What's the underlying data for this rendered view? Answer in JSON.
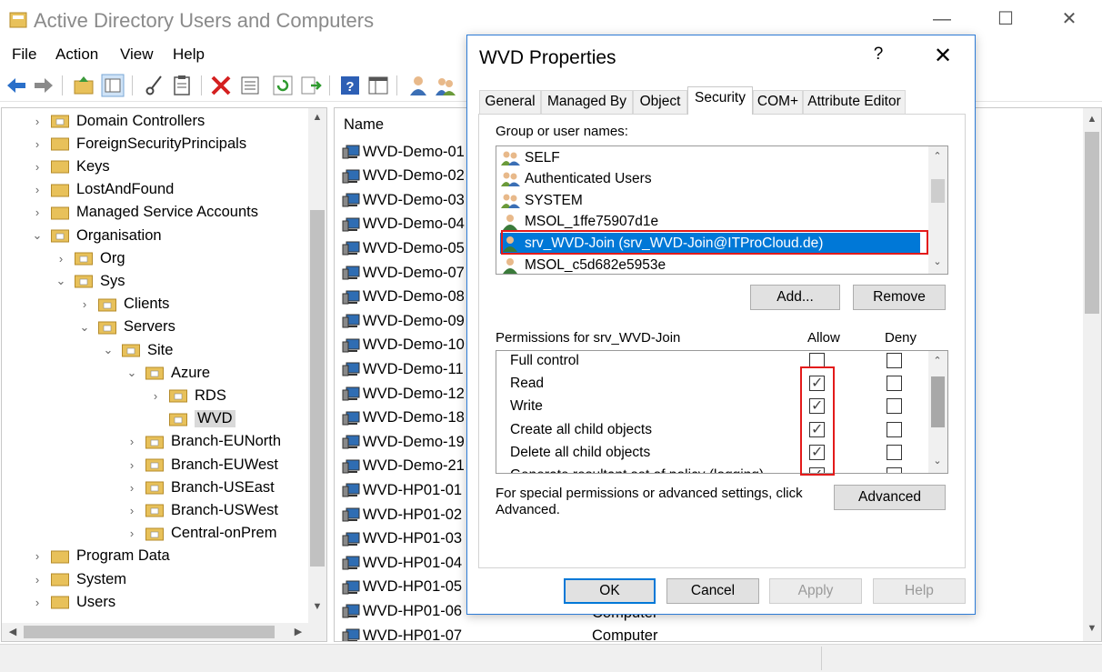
{
  "window": {
    "title": "Active Directory Users and Computers",
    "minimize": "—",
    "maximize": "☐",
    "close": "✕"
  },
  "menu": [
    "File",
    "Action",
    "View",
    "Help"
  ],
  "tree": {
    "items": [
      {
        "label": "Domain Controllers",
        "chevron": "›"
      },
      {
        "label": "ForeignSecurityPrincipals",
        "chevron": "›"
      },
      {
        "label": "Keys",
        "chevron": "›"
      },
      {
        "label": "LostAndFound",
        "chevron": "›"
      },
      {
        "label": "Managed Service Accounts",
        "chevron": "›"
      },
      {
        "label": "Organisation",
        "chevron": "⌄"
      },
      {
        "label": "Org",
        "chevron": "›"
      },
      {
        "label": "Sys",
        "chevron": "⌄"
      },
      {
        "label": "Clients",
        "chevron": "›"
      },
      {
        "label": "Servers",
        "chevron": "⌄"
      },
      {
        "label": "Site",
        "chevron": "⌄"
      },
      {
        "label": "Azure",
        "chevron": "⌄"
      },
      {
        "label": "RDS",
        "chevron": "›"
      },
      {
        "label": "WVD",
        "chevron": ""
      },
      {
        "label": "Branch-EUNorth",
        "chevron": "›"
      },
      {
        "label": "Branch-EUWest",
        "chevron": "›"
      },
      {
        "label": "Branch-USEast",
        "chevron": "›"
      },
      {
        "label": "Branch-USWest",
        "chevron": "›"
      },
      {
        "label": "Central-onPrem",
        "chevron": "›"
      },
      {
        "label": "Program Data",
        "chevron": "›"
      },
      {
        "label": "System",
        "chevron": "›"
      },
      {
        "label": "Users",
        "chevron": "›"
      }
    ],
    "selected": "WVD"
  },
  "list": {
    "column_name": "Name",
    "rows": [
      "WVD-Demo-01",
      "WVD-Demo-02",
      "WVD-Demo-03",
      "WVD-Demo-04",
      "WVD-Demo-05",
      "WVD-Demo-07",
      "WVD-Demo-08",
      "WVD-Demo-09",
      "WVD-Demo-10",
      "WVD-Demo-11",
      "WVD-Demo-12",
      "WVD-Demo-18",
      "WVD-Demo-19",
      "WVD-Demo-21",
      "WVD-HP01-01",
      "WVD-HP01-02",
      "WVD-HP01-03",
      "WVD-HP01-04",
      "WVD-HP01-05",
      "WVD-HP01-06",
      "WVD-HP01-07"
    ],
    "type_partial": "Computer",
    "type_partial_top": "Computer"
  },
  "dialog": {
    "title": "WVD Properties",
    "help": "?",
    "close": "✕",
    "tabs": [
      "General",
      "Managed By",
      "Object",
      "Security",
      "COM+",
      "Attribute Editor"
    ],
    "active_tab": "Security",
    "group_label": "Group or user names:",
    "users": [
      {
        "name": "SELF",
        "icon": "group-icon"
      },
      {
        "name": "Authenticated Users",
        "icon": "group-icon"
      },
      {
        "name": "SYSTEM",
        "icon": "group-icon"
      },
      {
        "name": "MSOL_1ffe75907d1e",
        "icon": "user-icon"
      },
      {
        "name": "srv_WVD-Join (srv_WVD-Join@ITProCloud.de)",
        "icon": "user-icon"
      },
      {
        "name": "MSOL_c5d682e5953e",
        "icon": "user-icon"
      }
    ],
    "selected_user": "srv_WVD-Join (srv_WVD-Join@ITProCloud.de)",
    "add_button": "Add...",
    "remove_button": "Remove",
    "permissions_label": "Permissions for srv_WVD-Join",
    "allow_header": "Allow",
    "deny_header": "Deny",
    "permissions": [
      {
        "name": "Full control",
        "allow": false,
        "deny": false
      },
      {
        "name": "Read",
        "allow": true,
        "deny": false
      },
      {
        "name": "Write",
        "allow": true,
        "deny": false
      },
      {
        "name": "Create all child objects",
        "allow": true,
        "deny": false
      },
      {
        "name": "Delete all child objects",
        "allow": true,
        "deny": false
      },
      {
        "name": "Generate resultant set of policy (logging)",
        "allow": true,
        "deny": false
      }
    ],
    "special_text": "For special permissions or advanced settings, click Advanced.",
    "advanced_button": "Advanced",
    "ok": "OK",
    "cancel": "Cancel",
    "apply": "Apply",
    "help_button": "Help"
  },
  "colors": {
    "selection": "#0078d7",
    "highlight_box": "#e31b1b",
    "folder": "#e8c15a"
  }
}
